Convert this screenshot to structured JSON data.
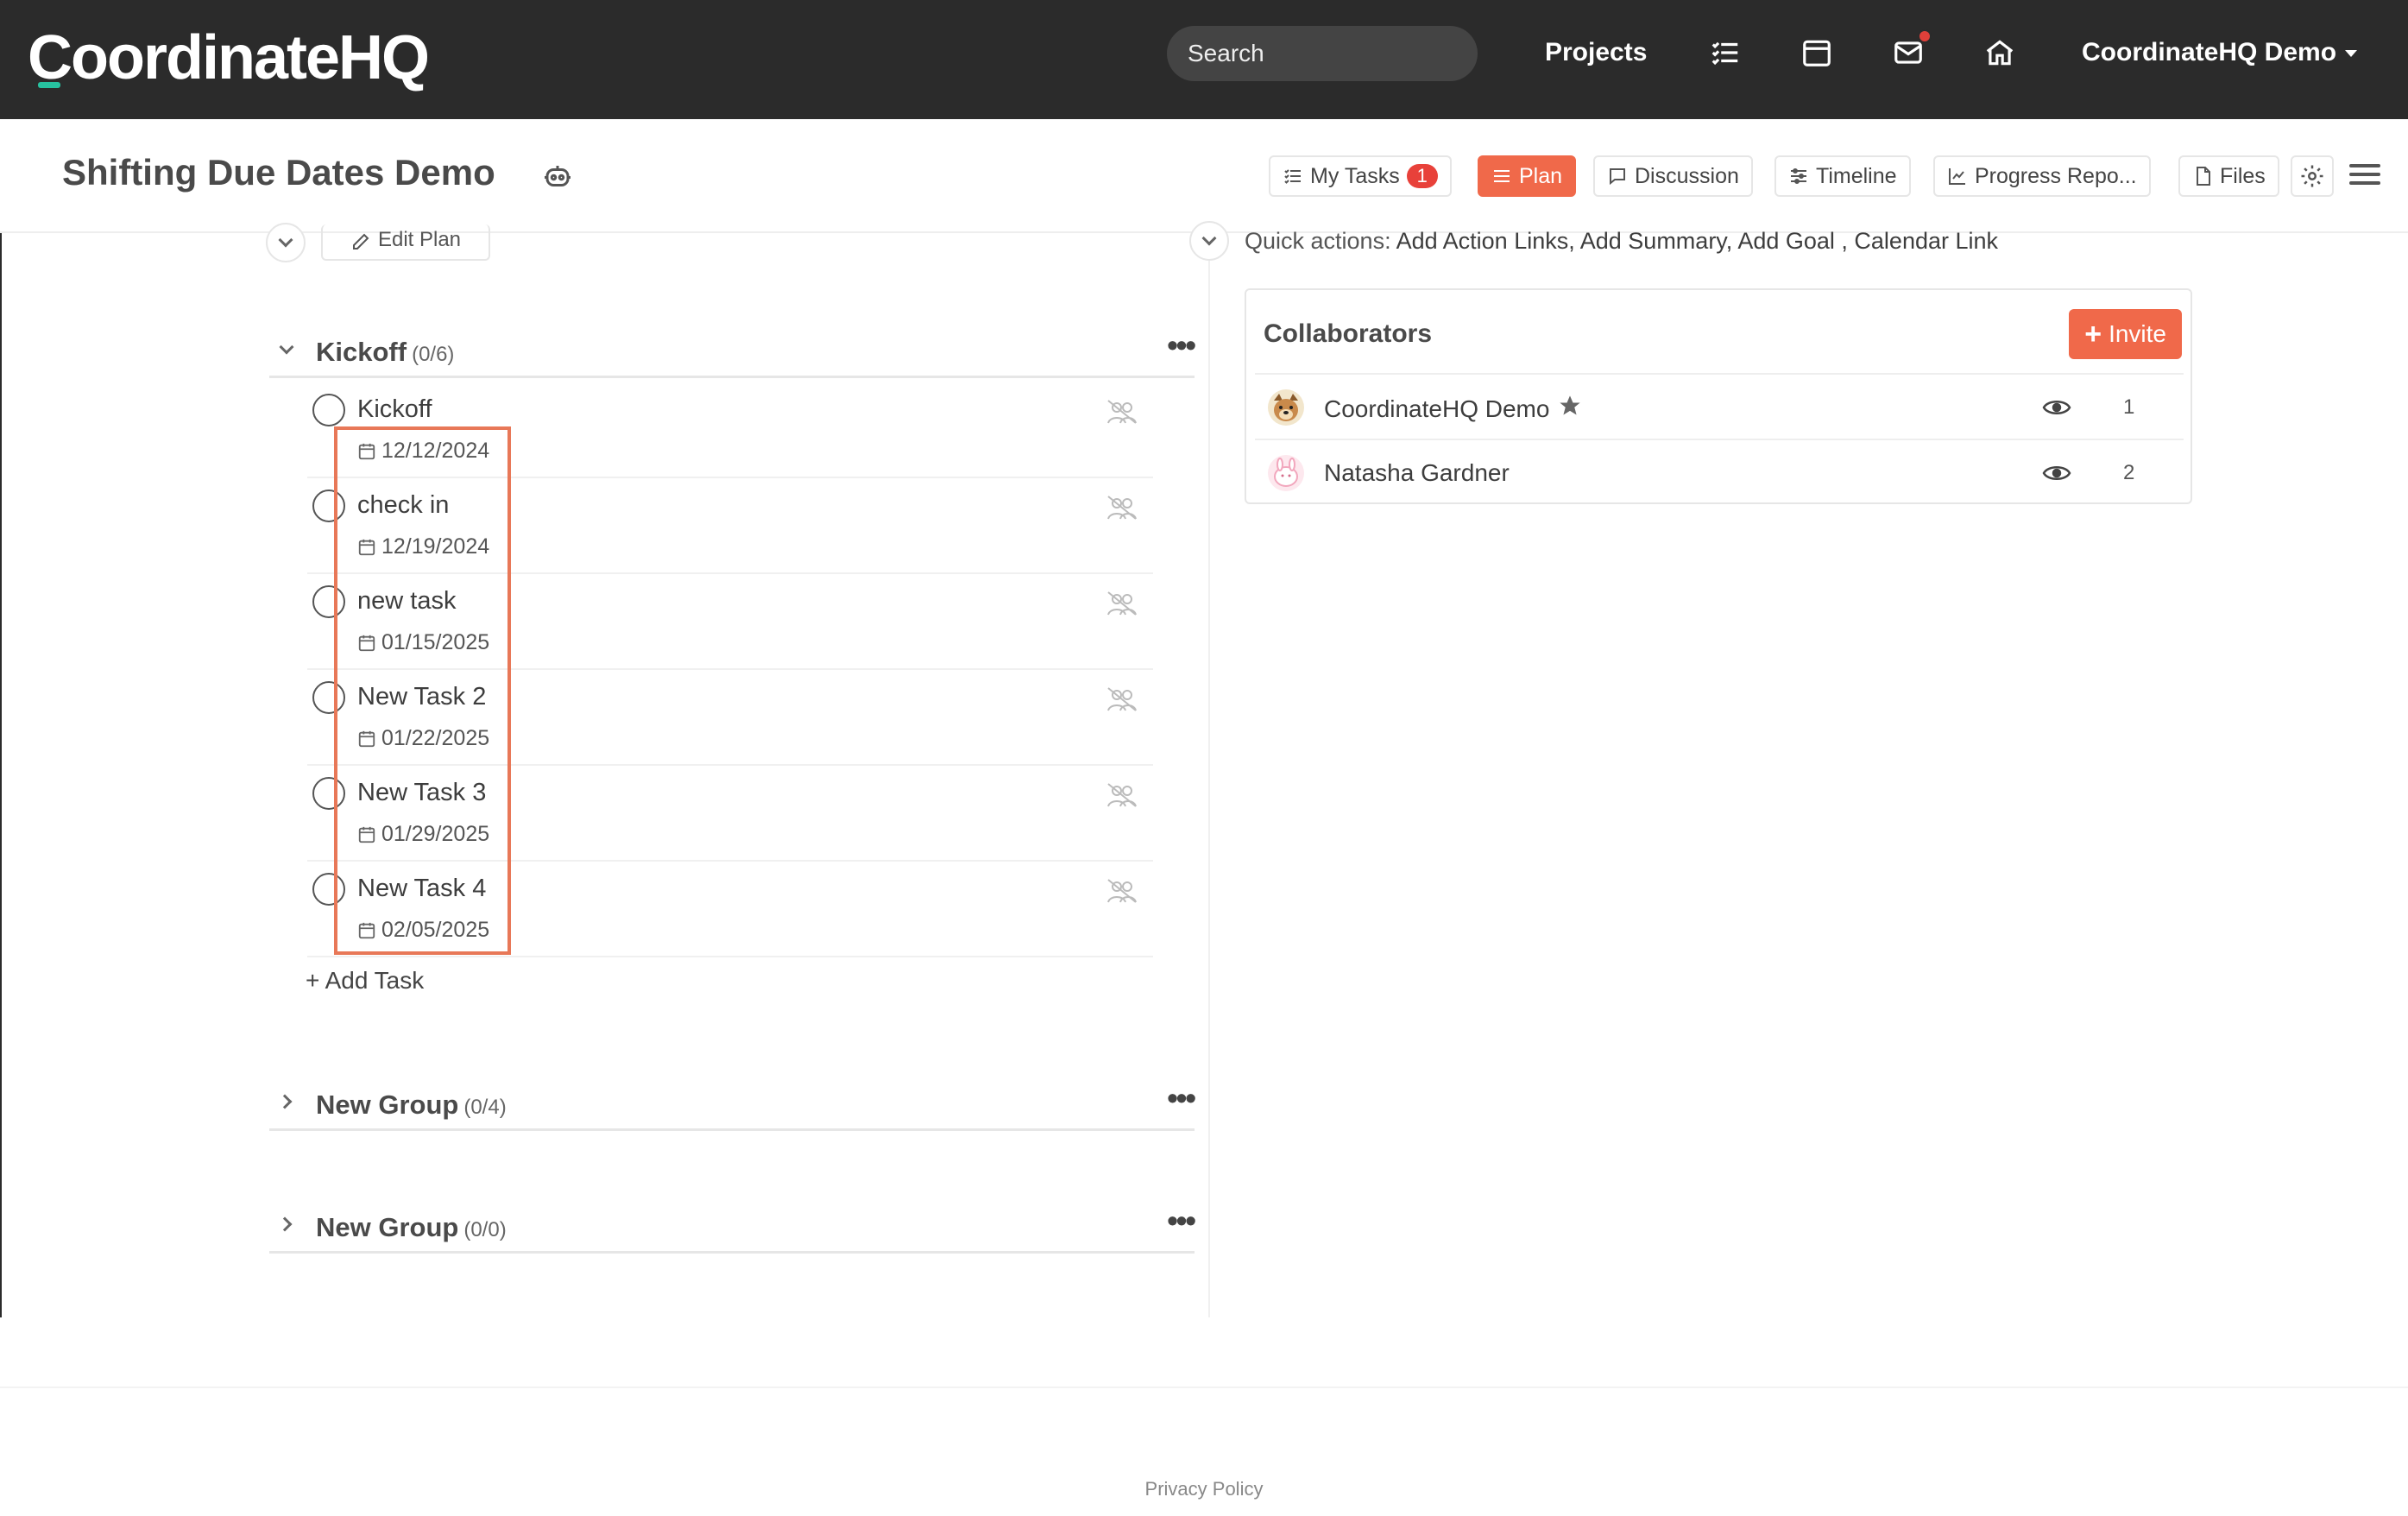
{
  "nav": {
    "logo": "CoordinateHQ",
    "search_placeholder": "Search",
    "projects_label": "Projects",
    "user_label": "CoordinateHQ Demo"
  },
  "header": {
    "title": "Shifting Due Dates Demo",
    "buttons": {
      "my_tasks": "My Tasks",
      "my_tasks_badge": "1",
      "plan": "Plan",
      "discussion": "Discussion",
      "timeline": "Timeline",
      "progress": "Progress Repo...",
      "files": "Files"
    }
  },
  "plan": {
    "edit_plan_label": "Edit Plan",
    "add_task_label": "+ Add Task",
    "groups": [
      {
        "title": "Kickoff",
        "count": "(0/6)",
        "expanded": true
      },
      {
        "title": "New Group",
        "count": "(0/4)",
        "expanded": false
      },
      {
        "title": "New Group",
        "count": "(0/0)",
        "expanded": false
      }
    ],
    "tasks": [
      {
        "name": "Kickoff",
        "date": "12/12/2024"
      },
      {
        "name": "check in",
        "date": "12/19/2024"
      },
      {
        "name": "new task",
        "date": "01/15/2025"
      },
      {
        "name": "New Task 2",
        "date": "01/22/2025"
      },
      {
        "name": "New Task 3",
        "date": "01/29/2025"
      },
      {
        "name": "New Task 4",
        "date": "02/05/2025"
      }
    ]
  },
  "quick_actions": {
    "prefix": "Quick actions:",
    "links": [
      "Add Action Links,",
      "Add Summary,",
      "Add Goal ,",
      "Calendar Link"
    ]
  },
  "collaborators": {
    "title": "Collaborators",
    "invite_label": "Invite",
    "people": [
      {
        "name": "CoordinateHQ Demo",
        "starred": true,
        "number": "1"
      },
      {
        "name": "Natasha Gardner",
        "starred": false,
        "number": "2"
      }
    ]
  },
  "footer": {
    "privacy": "Privacy Policy"
  },
  "colors": {
    "accent": "#f0694a",
    "nav_bg": "#2b2b2b",
    "highlight": "#e87858",
    "logo_accent": "#27c2a0"
  }
}
